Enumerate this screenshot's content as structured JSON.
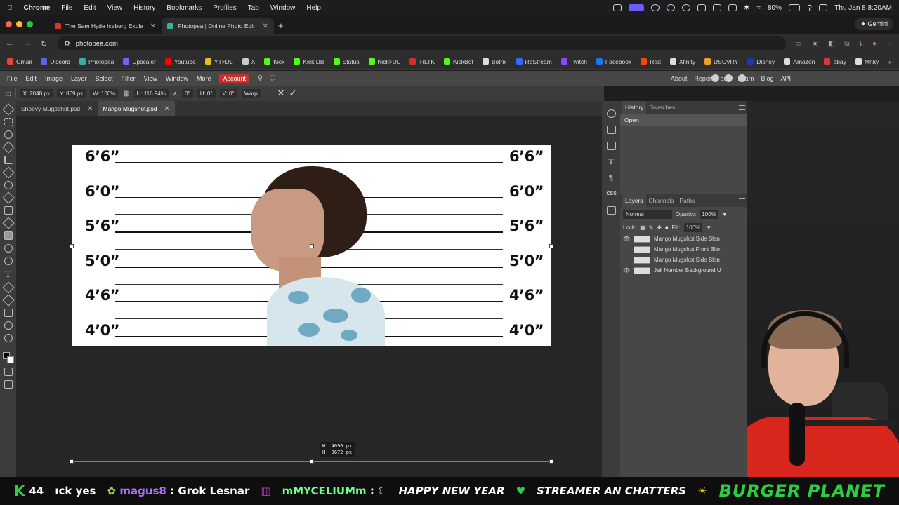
{
  "mac_menubar": {
    "items": [
      "Chrome",
      "File",
      "Edit",
      "View",
      "History",
      "Bookmarks",
      "Profiles",
      "Tab",
      "Window",
      "Help"
    ],
    "battery": "80%",
    "datetime": "Thu Jan 8  8:20AM"
  },
  "browser": {
    "tabs": [
      {
        "title": "The Sam Hyde Iceberg Expla",
        "color": "#e03030"
      },
      {
        "title": "Photopea | Online Photo Edit",
        "color": "#3ab0a0"
      }
    ],
    "gemini_label": "Gemini",
    "url": "photopea.com",
    "bookmarks": [
      {
        "label": "Gmail",
        "color": "#ea4335"
      },
      {
        "label": "Discord",
        "color": "#5865f2"
      },
      {
        "label": "Photopea",
        "color": "#3ab0a0"
      },
      {
        "label": "Upscaler",
        "color": "#7a5cff"
      },
      {
        "label": "Youtube",
        "color": "#ff0000"
      },
      {
        "label": "YT>DL",
        "color": "#e3c020"
      },
      {
        "label": "X",
        "color": "#cccccc"
      },
      {
        "label": "Kick",
        "color": "#53fc18"
      },
      {
        "label": "Kick DB",
        "color": "#53fc18"
      },
      {
        "label": "Status",
        "color": "#53fc18"
      },
      {
        "label": "Kick>DL",
        "color": "#53fc18"
      },
      {
        "label": "IRLTK",
        "color": "#d03030"
      },
      {
        "label": "KickBot",
        "color": "#53fc18"
      },
      {
        "label": "Botrix",
        "color": "#dddddd"
      },
      {
        "label": "ReStream",
        "color": "#2f6bff"
      },
      {
        "label": "Twitch",
        "color": "#9146ff"
      },
      {
        "label": "Facebook",
        "color": "#1877f2"
      },
      {
        "label": "Red",
        "color": "#ff4500"
      },
      {
        "label": "Xfinity",
        "color": "#dddddd"
      },
      {
        "label": "DSCVRY",
        "color": "#f0a020"
      },
      {
        "label": "Disney",
        "color": "#1a3bb0"
      },
      {
        "label": "Amazon",
        "color": "#dddddd"
      },
      {
        "label": "ebay",
        "color": "#e53238"
      },
      {
        "label": "Mnky",
        "color": "#dddddd"
      }
    ]
  },
  "photopea": {
    "menu": [
      "File",
      "Edit",
      "Image",
      "Layer",
      "Select",
      "Filter",
      "View",
      "Window",
      "More"
    ],
    "account_label": "Account",
    "right_links": [
      "About",
      "Report a bug",
      "Learn",
      "Blog",
      "API"
    ],
    "options": {
      "x": "X: 2048 px",
      "y": "Y: 869 px",
      "w": "W: 100%",
      "h": "H: 116.94%",
      "angle": "0°",
      "skew_h": "H: 0°",
      "skew_v": "V: 0°",
      "warp": "Warp"
    },
    "doc_tabs": [
      {
        "label": "Shoovy Mugpshot.psd",
        "active": false
      },
      {
        "label": "Mango Mugshot.psd",
        "active": true
      }
    ],
    "height_labels": [
      "6’6”",
      "6’0”",
      "5’6”",
      "5’0”",
      "4’6”",
      "4’0”"
    ],
    "size_tip": {
      "w": "W: 4096 px",
      "h": "H: 3672 px"
    },
    "history": {
      "tabs": [
        "History",
        "Swatches"
      ],
      "items": [
        "Open"
      ]
    },
    "layers": {
      "tabs": [
        "Layers",
        "Channels",
        "Paths"
      ],
      "blend": "Normal",
      "opacity_label": "Opacity:",
      "opacity": "100%",
      "lock_label": "Lock:",
      "fill_label": "Fill:",
      "fill": "100%",
      "items": [
        {
          "name": "Mango Mugshot Side Blan",
          "visible": "👁"
        },
        {
          "name": "Mango Mugshot Front Blar",
          "visible": ""
        },
        {
          "name": "Mango Mugshot Side Blan",
          "visible": ""
        },
        {
          "name": "Jail Number Background U",
          "visible": "👁"
        }
      ]
    }
  },
  "ticker": {
    "count": "44",
    "msg1": "ıck yes",
    "user1": "magus8",
    "msg2": ": Grok Lesnar",
    "user2": "mMYCELIUMm",
    "msg3": ":",
    "msg4": "HAPPY NEW YEAR",
    "msg5": "STREAMER AN CHATTERS",
    "brand": "BURGER PLANET"
  }
}
